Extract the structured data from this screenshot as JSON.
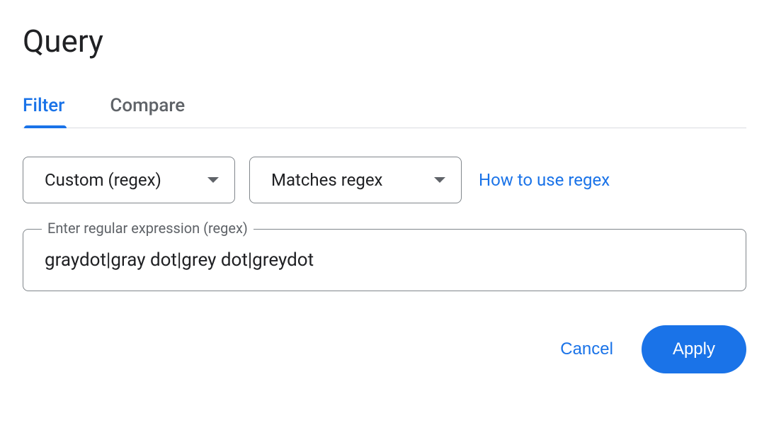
{
  "title": "Query",
  "tabs": {
    "filter": "Filter",
    "compare": "Compare"
  },
  "dropdowns": {
    "type": "Custom (regex)",
    "match": "Matches regex"
  },
  "help_link": "How to use regex",
  "field": {
    "legend": "Enter regular expression (regex)",
    "value": "graydot|gray dot|grey dot|greydot"
  },
  "buttons": {
    "cancel": "Cancel",
    "apply": "Apply"
  }
}
